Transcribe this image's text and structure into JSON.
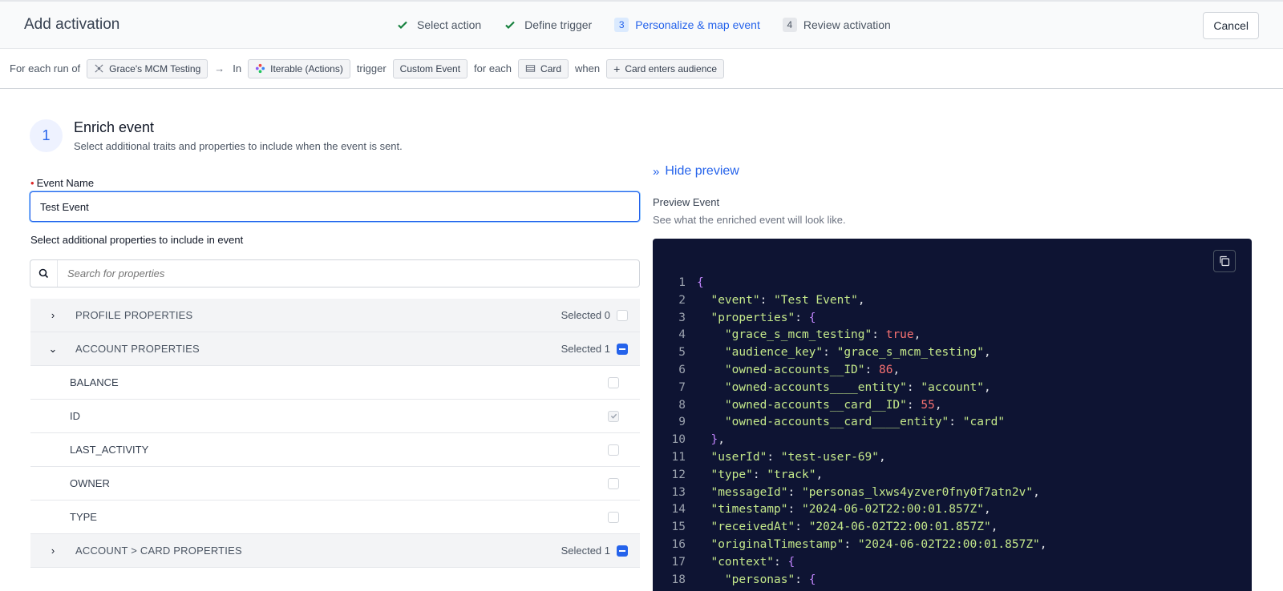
{
  "header": {
    "title": "Add activation",
    "steps": [
      {
        "label": "Select action",
        "state": "done"
      },
      {
        "label": "Define trigger",
        "state": "done"
      },
      {
        "label": "Personalize & map event",
        "state": "active",
        "num": "3"
      },
      {
        "label": "Review activation",
        "state": "todo",
        "num": "4"
      }
    ],
    "cancel": "Cancel"
  },
  "runbar": {
    "for_each_run_of": "For each run of",
    "source_chip": "Grace's MCM Testing",
    "in": "In",
    "destination_chip": "Iterable (Actions)",
    "trigger": "trigger",
    "trigger_chip": "Custom Event",
    "for_each": "for each",
    "entity_chip": "Card",
    "when": "when",
    "condition_chip": "Card enters audience"
  },
  "enrich": {
    "number": "1",
    "title": "Enrich event",
    "subtitle": "Select additional traits and properties to include when the event is sent.",
    "event_name_label": "Event Name",
    "required_mark": "•",
    "event_name_value": "Test Event",
    "props_label": "Select additional properties to include in event",
    "search_placeholder": "Search for properties",
    "groups": {
      "profile": {
        "name": "PROFILE PROPERTIES",
        "selected": "Selected 0"
      },
      "account": {
        "name": "ACCOUNT PROPERTIES",
        "selected": "Selected 1"
      },
      "card": {
        "name": "ACCOUNT > CARD PROPERTIES",
        "selected": "Selected 1"
      }
    },
    "account_items": [
      "BALANCE",
      "ID",
      "LAST_ACTIVITY",
      "OWNER",
      "TYPE"
    ]
  },
  "preview": {
    "hide_label": "Hide preview",
    "title": "Preview Event",
    "subtitle": "See what the enriched event will look like.",
    "code_lines": [
      {
        "n": "1",
        "parts": [
          [
            "p",
            "{"
          ]
        ]
      },
      {
        "n": "2",
        "parts": [
          [
            "w",
            "  "
          ],
          [
            "k",
            "\"event\""
          ],
          [
            "w",
            ": "
          ],
          [
            "s",
            "\"Test Event\""
          ],
          [
            "w",
            ","
          ]
        ]
      },
      {
        "n": "3",
        "parts": [
          [
            "w",
            "  "
          ],
          [
            "k",
            "\"properties\""
          ],
          [
            "w",
            ": "
          ],
          [
            "p",
            "{"
          ]
        ]
      },
      {
        "n": "4",
        "parts": [
          [
            "w",
            "    "
          ],
          [
            "k",
            "\"grace_s_mcm_testing\""
          ],
          [
            "w",
            ": "
          ],
          [
            "b",
            "true"
          ],
          [
            "w",
            ","
          ]
        ]
      },
      {
        "n": "5",
        "parts": [
          [
            "w",
            "    "
          ],
          [
            "k",
            "\"audience_key\""
          ],
          [
            "w",
            ": "
          ],
          [
            "s",
            "\"grace_s_mcm_testing\""
          ],
          [
            "w",
            ","
          ]
        ]
      },
      {
        "n": "6",
        "parts": [
          [
            "w",
            "    "
          ],
          [
            "k",
            "\"owned-accounts__ID\""
          ],
          [
            "w",
            ": "
          ],
          [
            "n",
            "86"
          ],
          [
            "w",
            ","
          ]
        ]
      },
      {
        "n": "7",
        "parts": [
          [
            "w",
            "    "
          ],
          [
            "k",
            "\"owned-accounts____entity\""
          ],
          [
            "w",
            ": "
          ],
          [
            "s",
            "\"account\""
          ],
          [
            "w",
            ","
          ]
        ]
      },
      {
        "n": "8",
        "parts": [
          [
            "w",
            "    "
          ],
          [
            "k",
            "\"owned-accounts__card__ID\""
          ],
          [
            "w",
            ": "
          ],
          [
            "n",
            "55"
          ],
          [
            "w",
            ","
          ]
        ]
      },
      {
        "n": "9",
        "parts": [
          [
            "w",
            "    "
          ],
          [
            "k",
            "\"owned-accounts__card____entity\""
          ],
          [
            "w",
            ": "
          ],
          [
            "s",
            "\"card\""
          ]
        ]
      },
      {
        "n": "10",
        "parts": [
          [
            "w",
            "  "
          ],
          [
            "p",
            "}"
          ],
          [
            "w",
            ","
          ]
        ]
      },
      {
        "n": "11",
        "parts": [
          [
            "w",
            "  "
          ],
          [
            "k",
            "\"userId\""
          ],
          [
            "w",
            ": "
          ],
          [
            "s",
            "\"test-user-69\""
          ],
          [
            "w",
            ","
          ]
        ]
      },
      {
        "n": "12",
        "parts": [
          [
            "w",
            "  "
          ],
          [
            "k",
            "\"type\""
          ],
          [
            "w",
            ": "
          ],
          [
            "s",
            "\"track\""
          ],
          [
            "w",
            ","
          ]
        ]
      },
      {
        "n": "13",
        "parts": [
          [
            "w",
            "  "
          ],
          [
            "k",
            "\"messageId\""
          ],
          [
            "w",
            ": "
          ],
          [
            "s",
            "\"personas_lxws4yzver0fny0f7atn2v\""
          ],
          [
            "w",
            ","
          ]
        ]
      },
      {
        "n": "14",
        "parts": [
          [
            "w",
            "  "
          ],
          [
            "k",
            "\"timestamp\""
          ],
          [
            "w",
            ": "
          ],
          [
            "s",
            "\"2024-06-02T22:00:01.857Z\""
          ],
          [
            "w",
            ","
          ]
        ]
      },
      {
        "n": "15",
        "parts": [
          [
            "w",
            "  "
          ],
          [
            "k",
            "\"receivedAt\""
          ],
          [
            "w",
            ": "
          ],
          [
            "s",
            "\"2024-06-02T22:00:01.857Z\""
          ],
          [
            "w",
            ","
          ]
        ]
      },
      {
        "n": "16",
        "parts": [
          [
            "w",
            "  "
          ],
          [
            "k",
            "\"originalTimestamp\""
          ],
          [
            "w",
            ": "
          ],
          [
            "s",
            "\"2024-06-02T22:00:01.857Z\""
          ],
          [
            "w",
            ","
          ]
        ]
      },
      {
        "n": "17",
        "parts": [
          [
            "w",
            "  "
          ],
          [
            "k",
            "\"context\""
          ],
          [
            "w",
            ": "
          ],
          [
            "p",
            "{"
          ]
        ]
      },
      {
        "n": "18",
        "parts": [
          [
            "w",
            "    "
          ],
          [
            "k",
            "\"personas\""
          ],
          [
            "w",
            ": "
          ],
          [
            "p",
            "{"
          ]
        ]
      }
    ]
  },
  "colors": {
    "accent": "#2563eb",
    "code_bg": "#0e1433",
    "check_green": "#15803d"
  }
}
